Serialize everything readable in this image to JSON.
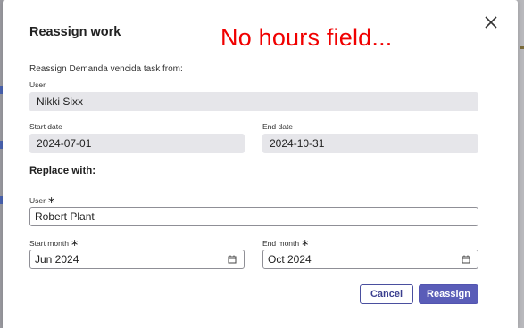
{
  "modal": {
    "title": "Reassign work",
    "annotation": "No hours field...",
    "close_icon": "close-icon"
  },
  "from": {
    "label": "Reassign Demanda vencida task from:",
    "user_label": "User",
    "user_value": "Nikki Sixx",
    "start_label": "Start date",
    "start_value": "2024-07-01",
    "end_label": "End date",
    "end_value": "2024-10-31"
  },
  "replace": {
    "heading": "Replace with:",
    "user_label": "User",
    "user_value": "Robert Plant",
    "start_label": "Start month",
    "start_value": "Jun 2024",
    "end_label": "End month",
    "end_value": "Oct 2024",
    "required_mark": "∗",
    "calendar_icon": "calendar-icon"
  },
  "actions": {
    "cancel": "Cancel",
    "reassign": "Reassign"
  },
  "colors": {
    "annotation": "#f00000",
    "primary": "#5a5db8",
    "readonly_bg": "#e6e6ea"
  }
}
